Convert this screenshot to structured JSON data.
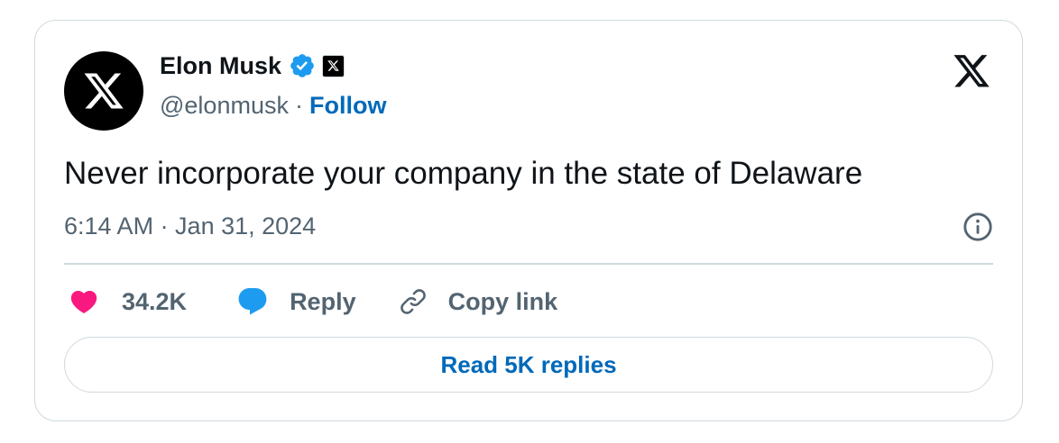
{
  "author": {
    "display_name": "Elon Musk",
    "handle": "@elonmusk",
    "separator": "·",
    "follow_label": "Follow"
  },
  "tweet": {
    "text": "Never incorporate your company in the state of Delaware",
    "timestamp": "6:14 AM · Jan 31, 2024"
  },
  "actions": {
    "like_count": "34.2K",
    "reply_label": "Reply",
    "copy_link_label": "Copy link"
  },
  "footer": {
    "read_replies_label": "Read 5K replies"
  },
  "colors": {
    "like": "#f91880",
    "reply": "#1d9bf0",
    "verified": "#1d9bf0",
    "link": "#0069b9",
    "muted_text": "#536471",
    "border": "#cfd9de"
  },
  "icons": [
    "x-logo-icon",
    "verified-badge-icon",
    "affiliate-badge-icon",
    "info-icon",
    "heart-icon",
    "speech-bubble-icon",
    "link-icon"
  ]
}
